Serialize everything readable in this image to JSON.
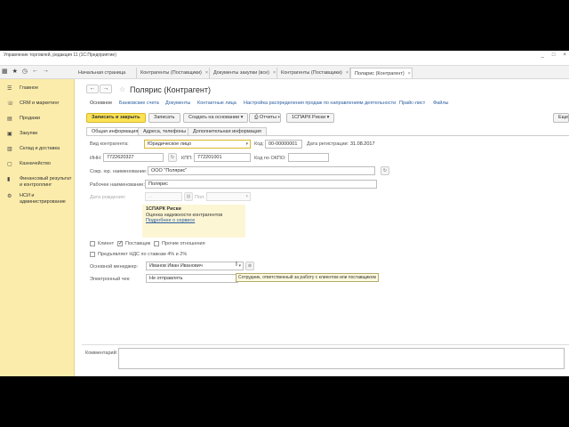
{
  "window": {
    "title": "Управление торговлей, редакция 11  (1С:Предприятие)",
    "controls": [
      "_",
      "□",
      "×"
    ]
  },
  "toolbar_icons": [
    "grid-icon",
    "star-icon",
    "history-icon",
    "back-icon",
    "forward-icon"
  ],
  "tabs": [
    {
      "label": "Начальная страница",
      "closable": false
    },
    {
      "label": "Контрагенты (Поставщики)",
      "closable": true
    },
    {
      "label": "Документы закупки (все)",
      "closable": true
    },
    {
      "label": "Контрагенты (Поставщики)",
      "closable": true
    },
    {
      "label": "Поларис (Контрагент)",
      "closable": true
    }
  ],
  "sidebar": {
    "items": [
      {
        "label": "Главное",
        "icon": "menu-icon"
      },
      {
        "label": "CRM и маркетинг",
        "icon": "crm-icon"
      },
      {
        "label": "Продажи",
        "icon": "sales-icon"
      },
      {
        "label": "Закупки",
        "icon": "purchases-icon"
      },
      {
        "label": "Склад и доставка",
        "icon": "warehouse-icon"
      },
      {
        "label": "Казначейство",
        "icon": "treasury-icon"
      },
      {
        "label": "Финансовый результат и контроллинг",
        "icon": "finance-icon"
      },
      {
        "label": "НСИ и администрирование",
        "icon": "settings-icon"
      }
    ]
  },
  "form": {
    "title": "Полярис (Контрагент)",
    "nav_links": [
      "Основное",
      "Банковские счета",
      "Документы",
      "Контактные лица",
      "Настройка распределения продаж по направлениям деятельности",
      "Прайс-лист",
      "Файлы"
    ],
    "buttons": {
      "save_close": "Записать и закрыть",
      "save": "Записать",
      "create_based": "Создать на основании",
      "print": "⎙",
      "reports": "Отчеты",
      "spark": "1СПАРК Риски",
      "more": "Еще"
    },
    "subtabs": [
      "Общая информация",
      "Адреса, телефоны",
      "Дополнительная информация"
    ],
    "fields": {
      "type_label": "Вид контрагента:",
      "type_value": "Юридическое лицо",
      "code_label": "Код:",
      "code_value": "00-00000001",
      "reg_date_label": "Дата регистрации:",
      "reg_date_value": "31.08.2017",
      "inn_label": "ИНН:",
      "inn_value": "7722620327",
      "kpp_label": "КПП:",
      "kpp_value": "772201001",
      "okpo_label": "Код по ОКПО:",
      "okpo_value": "",
      "short_name_label": "Сокр. юр. наименование:",
      "short_name_value": "ООО \"Полярис\"",
      "work_name_label": "Рабочее наименование:",
      "work_name_value": "Полярис",
      "birth_label": "Дата рождения:",
      "birth_value": ". .",
      "gender_label": "Пол:",
      "gender_value": "",
      "manager_label": "Основной менеджер:",
      "manager_value": "Иванов Иван Иванович",
      "echeck_label": "Электронный чек:",
      "echeck_value": "Не отправлять",
      "comment_label": "Комментарий:"
    },
    "risk": {
      "title": "1СПАРК Риски",
      "subtitle": "Оценка надежности контрагентов",
      "link": "Подробнее о сервисе"
    },
    "checkboxes": {
      "client": {
        "label": "Клиент",
        "checked": false
      },
      "supplier": {
        "label": "Поставщик",
        "checked": true
      },
      "other": {
        "label": "Прочие отношения",
        "checked": false
      },
      "vat": {
        "label": "Предъявляет НДС по ставкам 4% и 2%",
        "checked": false
      }
    },
    "tooltip": "Сотрудник, ответственный за работу с клиентом или поставщиком"
  }
}
